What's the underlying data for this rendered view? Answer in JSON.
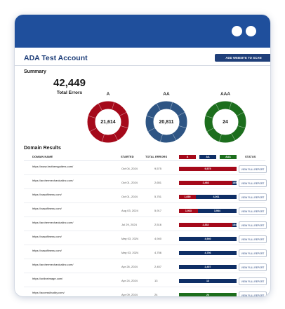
{
  "account": {
    "title": "ADA Test Account",
    "add_button": "ADD WEBSITE TO SCAN"
  },
  "summary": {
    "label": "Summary",
    "total": "42,449",
    "total_label": "Total Errors",
    "donuts": [
      {
        "title": "A",
        "value": "21,614",
        "color": "#a5091a"
      },
      {
        "title": "AA",
        "value": "20,811",
        "color": "#2e5584"
      },
      {
        "title": "AAA",
        "value": "24",
        "color": "#1c6e1d"
      }
    ]
  },
  "results": {
    "label": "Domain Results",
    "headers": {
      "domain": "DOMAIN NAME",
      "started": "STARTED",
      "errors": "TOTAL ERRORS",
      "status": "STATUS"
    },
    "legend": [
      {
        "label": "A",
        "color": "#a5091a"
      },
      {
        "label": "AA",
        "color": "#0f2f66"
      },
      {
        "label": "AAA",
        "color": "#1c6e1d"
      }
    ],
    "button_label": "VIEW FULL REPORT",
    "rows": [
      {
        "domain": "https://www.brothersgutters.com/",
        "started": "Oct 04, 2024",
        "total": "9,575",
        "a": 9575,
        "aa": 0,
        "aaa": 0,
        "a_label": "9,575",
        "aa_label": "",
        "aaa_label": ""
      },
      {
        "domain": "https://archermechanicalinc.com/",
        "started": "Oct 01, 2024",
        "total": "2,651",
        "a": 2466,
        "aa": 185,
        "aaa": 0,
        "a_label": "2,466",
        "aa_label": "185",
        "aaa_label": ""
      },
      {
        "domain": "https://vasafitness.com/",
        "started": "Oct 01, 2024",
        "total": "5,751",
        "a": 1690,
        "aa": 4061,
        "aaa": 0,
        "a_label": "1,690",
        "aa_label": "4,061",
        "aaa_label": ""
      },
      {
        "domain": "https://vasafitness.com/",
        "started": "Aug 03, 2024",
        "total": "5,917",
        "a": 1933,
        "aa": 3984,
        "aaa": 0,
        "a_label": "1,933",
        "aa_label": "3,984",
        "aaa_label": ""
      },
      {
        "domain": "https://archermechanicalinc.com/",
        "started": "Jul 29, 2024",
        "total": "2,516",
        "a": 2332,
        "aa": 184,
        "aaa": 0,
        "a_label": "2,332",
        "aa_label": "184",
        "aaa_label": ""
      },
      {
        "domain": "https://vasafitness.com/",
        "started": "May 03, 2024",
        "total": "4,940",
        "a": 0,
        "aa": 4940,
        "aaa": 0,
        "a_label": "",
        "aa_label": "4,940",
        "aaa_label": ""
      },
      {
        "domain": "https://vasafitness.com/",
        "started": "May 03, 2024",
        "total": "4,756",
        "a": 0,
        "aa": 4756,
        "aaa": 0,
        "a_label": "",
        "aa_label": "4,756",
        "aaa_label": ""
      },
      {
        "domain": "https://archermechanicalinc.com/",
        "started": "Apr 26, 2024",
        "total": "2,457",
        "a": 0,
        "aa": 2457,
        "aaa": 0,
        "a_label": "",
        "aa_label": "2,457",
        "aaa_label": ""
      },
      {
        "domain": "https://onlineimage.com/",
        "started": "Apr 24, 2024",
        "total": "13",
        "a": 0,
        "aa": 13,
        "aaa": 0,
        "a_label": "",
        "aa_label": "13",
        "aaa_label": ""
      },
      {
        "domain": "https://accessibuddy.com/",
        "started": "Apr 09, 2024",
        "total": "24",
        "a": 0,
        "aa": 0,
        "aaa": 24,
        "a_label": "",
        "aa_label": "",
        "aaa_label": "24"
      }
    ]
  }
}
